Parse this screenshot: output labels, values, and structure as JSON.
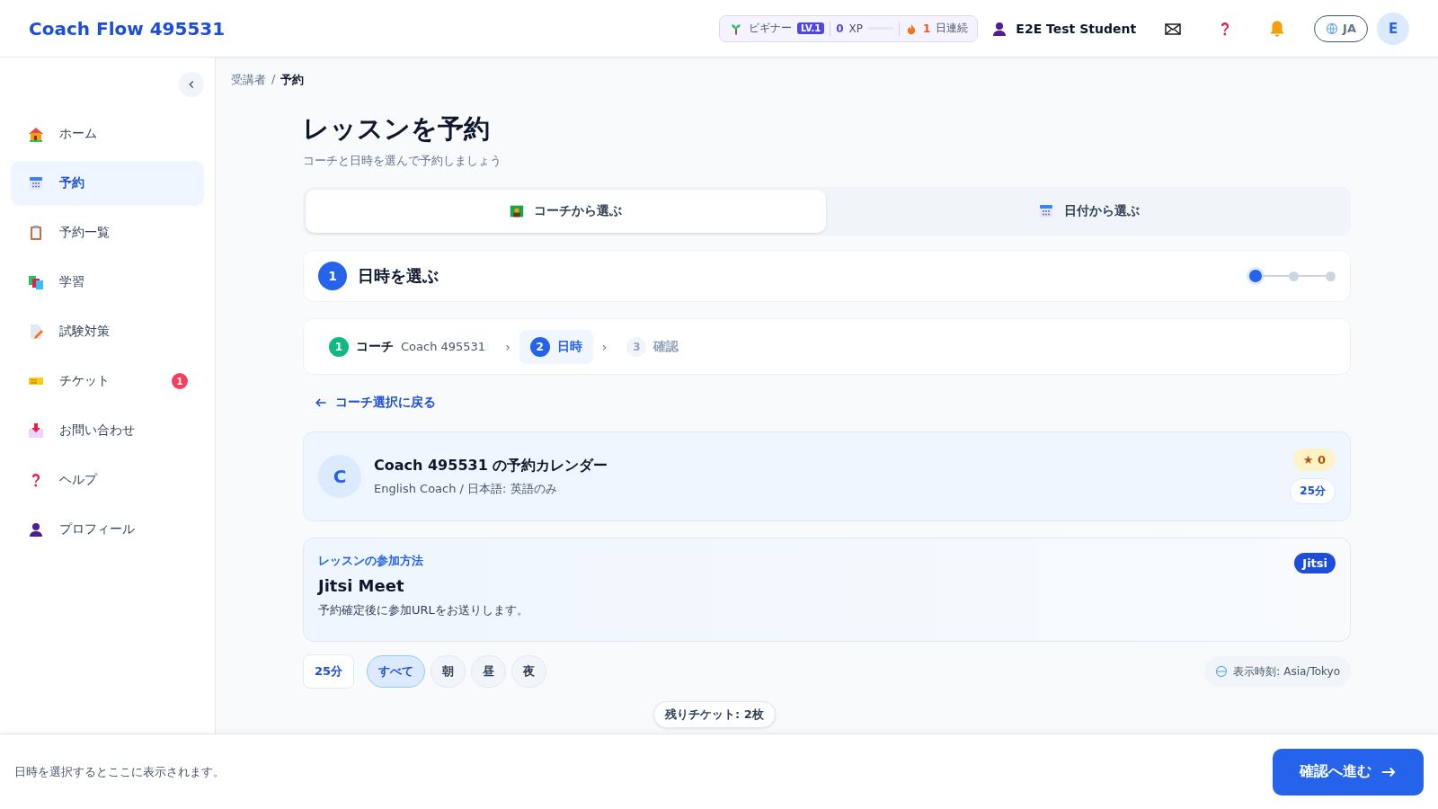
{
  "header": {
    "brand": "Coach Flow 495531",
    "rank": "ビギナー",
    "level_badge": "LV.1",
    "xp_value": "0",
    "xp_unit": "XP",
    "xp_progress": {
      "level": 0
    },
    "streak_value": "1",
    "streak_unit": "日連続",
    "user_name": "E2E Test Student",
    "language": "JA",
    "avatar": "E"
  },
  "sidebar": {
    "items": [
      {
        "label": "ホーム",
        "selected": false
      },
      {
        "label": "予約",
        "selected": true
      },
      {
        "label": "予約一覧",
        "selected": false
      },
      {
        "label": "学習",
        "selected": false
      },
      {
        "label": "試験対策",
        "selected": false
      },
      {
        "label": "チケット",
        "selected": false,
        "badge": "1"
      },
      {
        "label": "お問い合わせ",
        "selected": false
      },
      {
        "label": "ヘルプ",
        "selected": false
      },
      {
        "label": "プロフィール",
        "selected": false
      }
    ]
  },
  "breadcrumb": {
    "items": [
      "受講者",
      "予約"
    ],
    "separator": "/"
  },
  "title": "レッスンを予約",
  "subtitle": "コーチと日時を選んで予約しましょう",
  "mode_tabs": [
    {
      "label": "コーチから選ぶ",
      "selected": true
    },
    {
      "label": "日付から選ぶ",
      "selected": false
    }
  ],
  "step_header": {
    "number": "1",
    "title": "日時を選ぶ",
    "dots": [
      {
        "active": true
      },
      {
        "active": false
      },
      {
        "active": false
      }
    ]
  },
  "steps": {
    "separator": "›",
    "items": [
      {
        "number": "1",
        "label": "コーチ",
        "detail": "Coach 495531",
        "kind": "done"
      },
      {
        "number": "2",
        "label": "日時",
        "kind": "current"
      },
      {
        "number": "3",
        "label": "確認",
        "kind": "upcoming"
      }
    ]
  },
  "back_link": "コーチ選択に戻る",
  "coach_card": {
    "avatar": "C",
    "title": "Coach 495531 の予約カレンダー",
    "subtitle": "English Coach / 日本語: 英語のみ",
    "rating": "★ 0",
    "duration": "25分"
  },
  "join_card": {
    "eyebrow": "レッスンの参加方法",
    "title": "Jitsi Meet",
    "text": "予約確定後に参加URLをお送りします。",
    "badge": "Jitsi"
  },
  "filters": {
    "duration": "25分",
    "times": [
      {
        "label": "すべて",
        "selected": true
      },
      {
        "label": "朝",
        "selected": false
      },
      {
        "label": "昼",
        "selected": false
      },
      {
        "label": "夜",
        "selected": false
      }
    ],
    "timezone": "表示時刻: Asia/Tokyo"
  },
  "tickets_pill": "残りチケット: 2枚",
  "footer": {
    "hint": "日時を選択するとここに表示されます。",
    "button": "確認へ進む"
  }
}
